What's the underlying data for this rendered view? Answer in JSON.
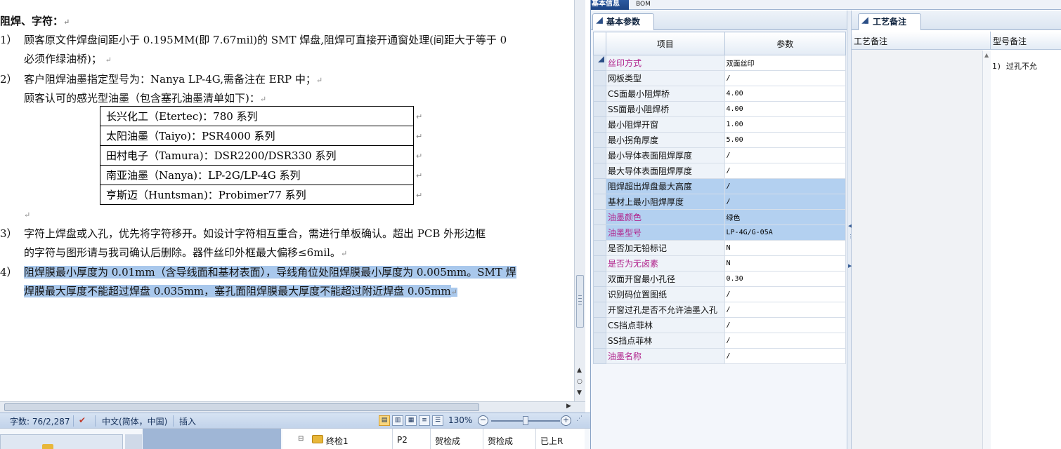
{
  "document": {
    "heading": "阻焊、字符：",
    "items": [
      {
        "num": "1）",
        "lines": [
          "顾客原文件焊盘间距小于 0.195MM(即 7.67mil)的 SMT 焊盘,阻焊可直接开通窗处理(间距大于等于 0",
          "必须作绿油桥)；"
        ]
      },
      {
        "num": "2）",
        "lines": [
          "客户阻焊油墨指定型号为：Nanya  LP-4G,需备注在 ERP 中；",
          "顾客认可的感光型油墨（包含塞孔油墨清单如下)："
        ]
      },
      {
        "num": "3）",
        "lines": [
          "字符上焊盘或入孔，优先将字符移开。如设计字符相互重合，需进行单板确认。超出 PCB 外形边框",
          "的字符与图形请与我司确认后删除。器件丝印外框最大偏移≤6mil。"
        ]
      },
      {
        "num": "4）",
        "lines": [
          "阻焊膜最小厚度为 0.01mm（含导线面和基材表面），导线角位处阻焊膜最小厚度为 0.005mm。SMT 焊",
          "焊膜最大厚度不能超过焊盘 0.035mm，塞孔面阻焊膜最大厚度不能超过附近焊盘 0.05mm"
        ]
      }
    ],
    "ink_list": [
      "长兴化工（Etertec)：780 系列",
      "太阳油墨（Taiyo)：PSR4000 系列",
      "田村电子（Tamura)：DSR2200/DSR330 系列",
      "南亚油墨（Nanya)：LP-2G/LP-4G 系列",
      "亨斯迈（Huntsman)：Probimer77 系列"
    ],
    "para_mark": "↵",
    "cell_mark": "↵"
  },
  "statusbar": {
    "word_count": "字数: 76/2,287",
    "language": "中文(简体，中国)",
    "mode": "插入",
    "zoom": "130%"
  },
  "bottom_grid": {
    "cells": [
      "终检1",
      "P2",
      "贺检成",
      "贺检成",
      "已上R"
    ]
  },
  "erp": {
    "top_tabs": [
      "基本信息",
      "BOM"
    ],
    "left_tab": "基本参数",
    "right_tab": "工艺备注",
    "columns": {
      "item": "项目",
      "param": "参数"
    },
    "rows": [
      {
        "name": "丝印方式",
        "value": "双面丝印",
        "pink": true,
        "selected": false
      },
      {
        "name": "网板类型",
        "value": "/",
        "pink": false,
        "selected": false
      },
      {
        "name": "CS面最小阻焊桥",
        "value": "4.00",
        "pink": false,
        "selected": false
      },
      {
        "name": "SS面最小阻焊桥",
        "value": "4.00",
        "pink": false,
        "selected": false
      },
      {
        "name": "最小阻焊开窗",
        "value": "1.00",
        "pink": false,
        "selected": false
      },
      {
        "name": "最小拐角厚度",
        "value": "5.00",
        "pink": false,
        "selected": false
      },
      {
        "name": "最小导体表面阻焊厚度",
        "value": "/",
        "pink": false,
        "selected": false
      },
      {
        "name": "最大导体表面阻焊厚度",
        "value": "/",
        "pink": false,
        "selected": false
      },
      {
        "name": "阻焊超出焊盘最大高度",
        "value": "/",
        "pink": false,
        "selected": true
      },
      {
        "name": "基材上最小阻焊厚度",
        "value": "/",
        "pink": false,
        "selected": true
      },
      {
        "name": "油墨颜色",
        "value": "绿色",
        "pink": true,
        "selected": true
      },
      {
        "name": "油墨型号",
        "value": "LP-4G/G-05A",
        "pink": true,
        "selected": true
      },
      {
        "name": "是否加无铅标记",
        "value": "N",
        "pink": false,
        "selected": false
      },
      {
        "name": "是否为无卤素",
        "value": "N",
        "pink": true,
        "selected": false
      },
      {
        "name": "双面开窗最小孔径",
        "value": "0.30",
        "pink": false,
        "selected": false
      },
      {
        "name": "识别码位置图纸",
        "value": "/",
        "pink": false,
        "selected": false
      },
      {
        "name": "开窗过孔是否不允许油墨入孔",
        "value": "/",
        "pink": false,
        "selected": false
      },
      {
        "name": "CS挡点菲林",
        "value": "/",
        "pink": false,
        "selected": false
      },
      {
        "name": "SS挡点菲林",
        "value": "/",
        "pink": false,
        "selected": false
      },
      {
        "name": "油墨名称",
        "value": "/",
        "pink": true,
        "selected": false
      }
    ],
    "notes_headers": {
      "process": "工艺备注",
      "model": "型号备注"
    },
    "model_note": "1)      过孔不允"
  }
}
